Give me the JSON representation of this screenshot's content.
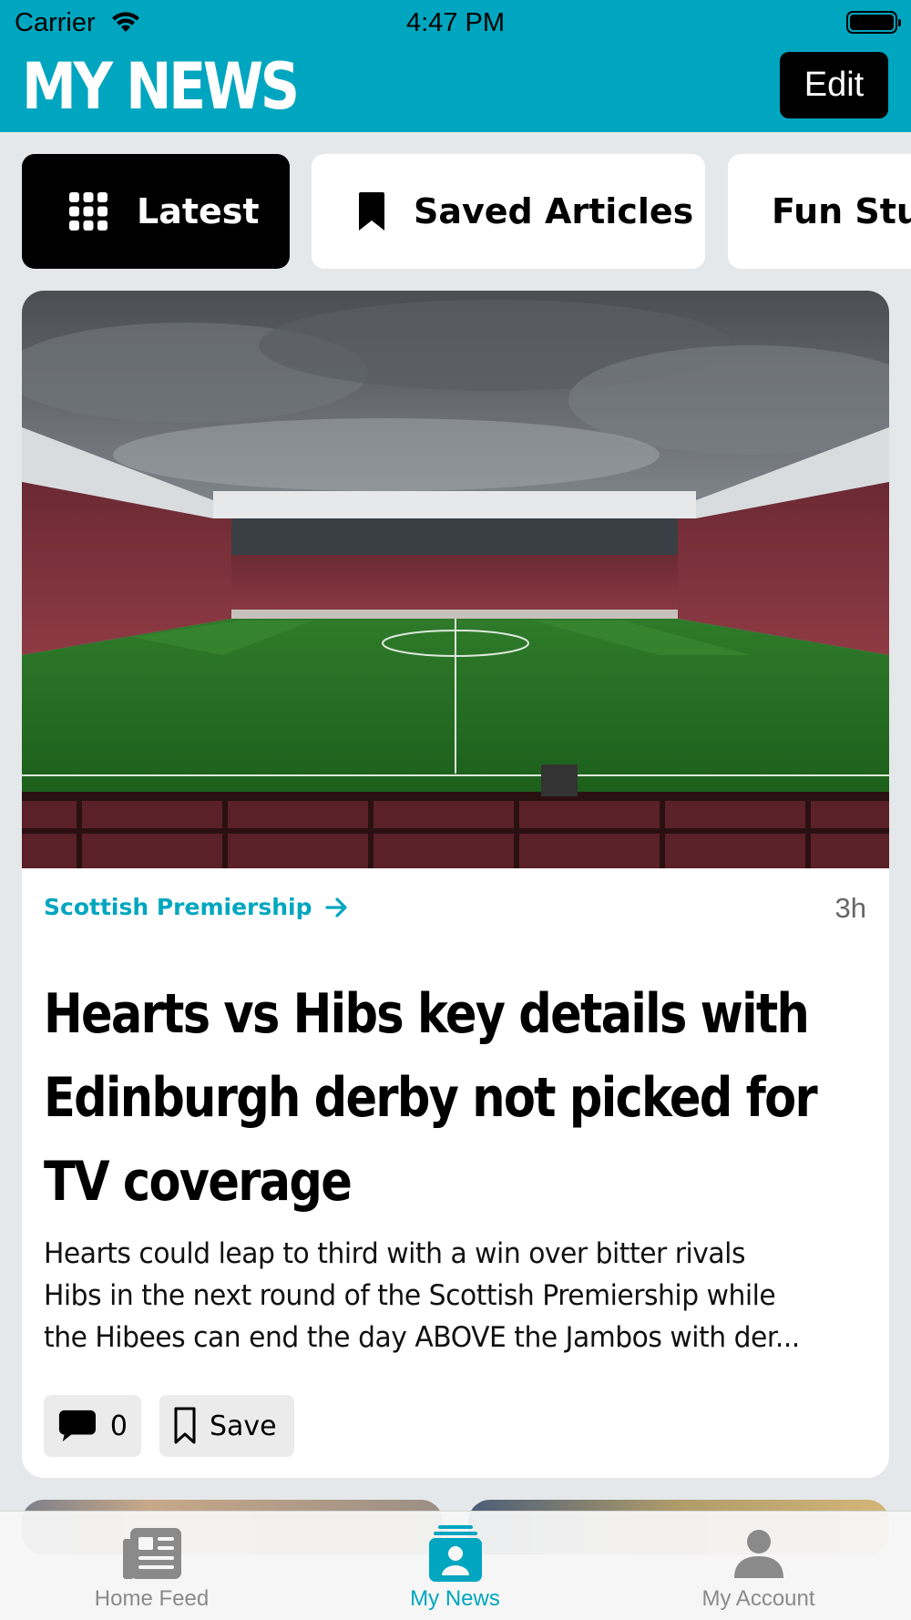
{
  "status_bar": {
    "carrier": "Carrier",
    "time": "4:47 PM"
  },
  "header": {
    "title": "MY NEWS",
    "edit_label": "Edit"
  },
  "tabs": [
    {
      "label": "Latest",
      "icon": "grid-icon",
      "active": true
    },
    {
      "label": "Saved Articles",
      "icon": "bookmark-icon",
      "active": false
    },
    {
      "label": "Fun Stuff",
      "icon": "",
      "active": false
    }
  ],
  "article": {
    "category": "Scottish Premiership",
    "age": "3h",
    "headline_lines": [
      "Hearts vs Hibs key details with",
      "Edinburgh derby not picked for",
      "TV coverage"
    ],
    "summary_lines": [
      "Hearts could leap to third with a win over bitter rivals",
      "Hibs in the next round of the Scottish Premiership while",
      "the Hibees can end the day ABOVE the Jambos with der..."
    ],
    "comment_count": "0",
    "save_label": "Save"
  },
  "tab_bar": {
    "items": [
      {
        "label": "Home Feed",
        "icon": "newspaper-icon",
        "active": false
      },
      {
        "label": "My News",
        "icon": "person-card-icon",
        "active": true
      },
      {
        "label": "My Account",
        "icon": "person-icon",
        "active": false
      }
    ]
  },
  "colors": {
    "accent": "#00a6bf",
    "background": "#e4e8ea",
    "inactive_tab_label": "#8a8a8a"
  }
}
